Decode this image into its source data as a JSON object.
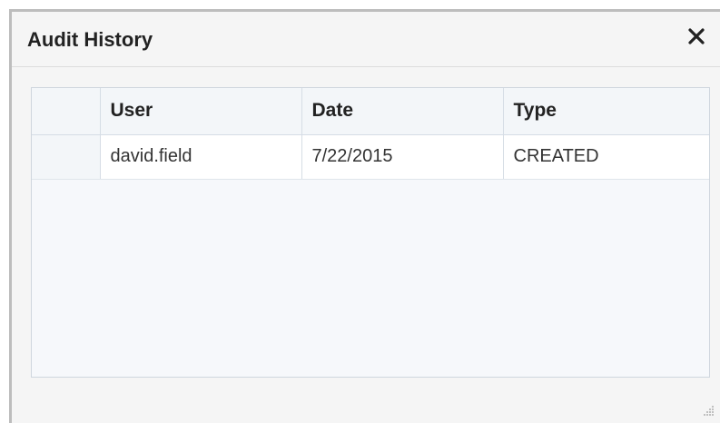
{
  "dialog": {
    "title": "Audit History"
  },
  "grid": {
    "columns": [
      "User",
      "Date",
      "Type"
    ],
    "rows": [
      [
        "david.field",
        "7/22/2015",
        "CREATED"
      ]
    ]
  },
  "icons": {
    "close": "close-icon",
    "resize": "resize-grip-icon"
  }
}
